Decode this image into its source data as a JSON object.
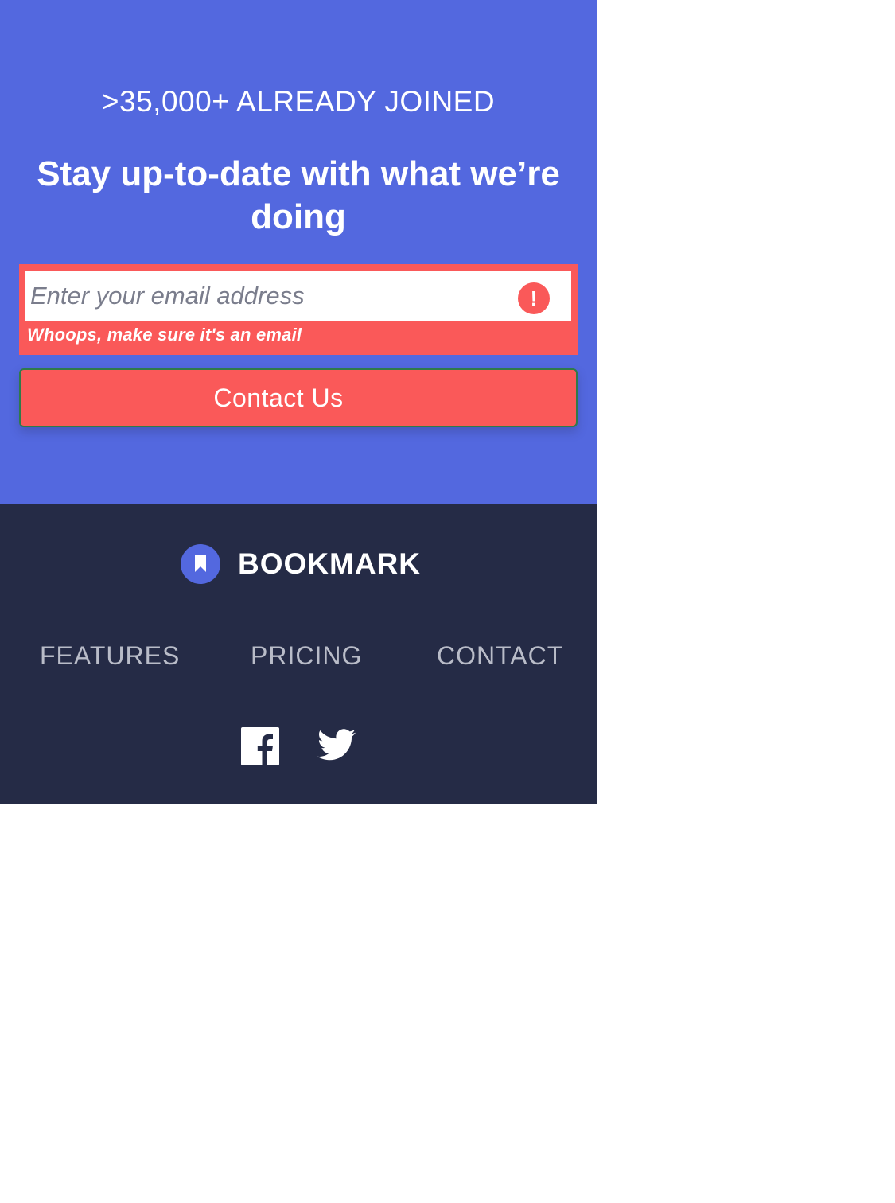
{
  "cta": {
    "kicker": ">35,000+ ALREADY JOINED",
    "heading": "Stay up-to-date with what we’re doing",
    "email_placeholder": "Enter your email address",
    "email_value": "",
    "error_icon": "!",
    "error_message": "Whoops, make sure it's an email",
    "button_label": "Contact Us"
  },
  "footer": {
    "logo_text": "BOOKMARK",
    "logo_icon": "bookmark-icon",
    "nav": {
      "features": "FEATURES",
      "pricing": "PRICING",
      "contact": "CONTACT"
    },
    "social": {
      "facebook_icon": "facebook-icon",
      "twitter_icon": "twitter-icon"
    }
  },
  "colors": {
    "cta_background": "#5368df",
    "footer_background": "#252b46",
    "error_red": "#fa5959",
    "nav_gray": "#b9bcc8"
  }
}
